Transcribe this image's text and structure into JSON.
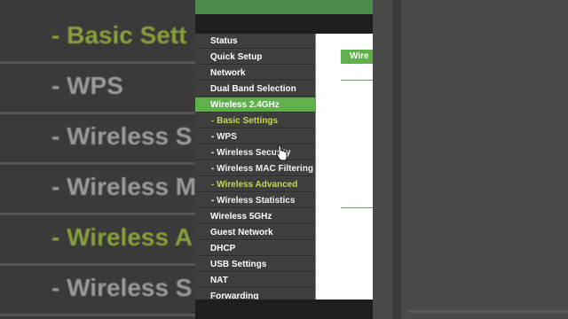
{
  "backdrop_left": {
    "rows": [
      {
        "text": "- Basic Sett",
        "green": true
      },
      {
        "text": "- WPS",
        "green": false
      },
      {
        "text": "- Wireless S",
        "green": false
      },
      {
        "text": "- Wireless M",
        "green": false
      },
      {
        "text": "- Wireless A",
        "green": true
      },
      {
        "text": "- Wireless S",
        "green": false
      }
    ]
  },
  "menu": {
    "items": [
      {
        "label": "Status",
        "type": "top"
      },
      {
        "label": "Quick Setup",
        "type": "top"
      },
      {
        "label": "Network",
        "type": "top"
      },
      {
        "label": "Dual Band Selection",
        "type": "top"
      },
      {
        "label": "Wireless 2.4GHz",
        "type": "active"
      },
      {
        "label": "- Basic Settings",
        "type": "sub-active"
      },
      {
        "label": "- WPS",
        "type": "sub"
      },
      {
        "label": "- Wireless Security",
        "type": "sub"
      },
      {
        "label": "- Wireless MAC Filtering",
        "type": "sub"
      },
      {
        "label": "- Wireless Advanced",
        "type": "sub-active"
      },
      {
        "label": "- Wireless Statistics",
        "type": "sub"
      },
      {
        "label": "Wireless 5GHz",
        "type": "top"
      },
      {
        "label": "Guest Network",
        "type": "top"
      },
      {
        "label": "DHCP",
        "type": "top"
      },
      {
        "label": "USB Settings",
        "type": "top"
      },
      {
        "label": "NAT",
        "type": "top"
      },
      {
        "label": "Forwarding",
        "type": "top"
      }
    ]
  },
  "content": {
    "tab_label": "Wire"
  },
  "colors": {
    "accent_green": "#5fb04b",
    "sub_highlight": "#c8d84e",
    "menu_bg": "#3e3e3e"
  }
}
